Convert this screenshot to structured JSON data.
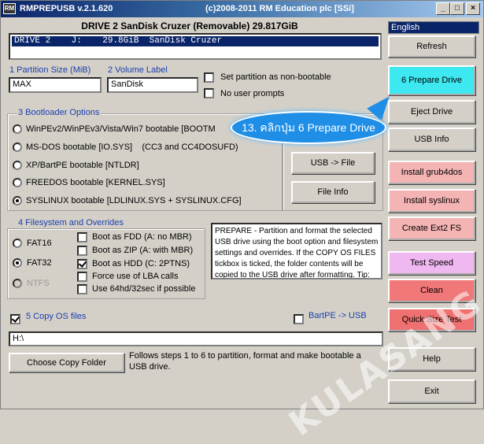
{
  "titlebar": {
    "app_icon": "RM",
    "app": "RMPREPUSB v.2.1.620",
    "copyright": "(c)2008-2011 RM Education plc [SSi]",
    "minimize": "_",
    "maximize": "□",
    "close": "×"
  },
  "drive": {
    "title": "DRIVE 2  SanDisk Cruzer  (Removable) 29.817GiB",
    "list_row": "DRIVE 2    J:    29.8GiB  SanDisk Cruzer"
  },
  "language": "English",
  "partition": {
    "size_label": "1 Partition Size (MiB)",
    "size_value": "MAX",
    "volume_label": "2 Volume Label",
    "volume_value": "SanDisk",
    "non_bootable": "Set partition as non-bootable",
    "no_prompts": "No user prompts"
  },
  "bootloader": {
    "title": "3 Bootloader Options",
    "options": [
      "WinPEv2/WinPEv3/Vista/Win7 bootable [BOOTM",
      "MS-DOS bootable [IO.SYS]    (CC3 and CC4DOSUFD)",
      "XP/BartPE bootable [NTLDR]",
      "FREEDOS bootable [KERNEL.SYS]",
      "SYSLINUX bootable [LDLINUX.SYS + SYSLINUX.CFG]"
    ]
  },
  "mid_buttons": {
    "usb_to_file": "USB -> File",
    "file_info": "File Info"
  },
  "filesystem": {
    "title": "4 Filesystem and Overrides",
    "fat16": "FAT16",
    "fat32": "FAT32",
    "ntfs": "NTFS",
    "boot_fdd": "Boot as FDD (A: no MBR)",
    "boot_zip": "Boot as ZIP (A: with MBR)",
    "boot_hdd": "Boot as HDD (C: 2PTNS)",
    "force_lba": "Force use of LBA calls",
    "use_64hd": "Use 64hd/32sec if possible"
  },
  "info_text": "PREPARE - Partition and format the selected USB drive using the boot option and filesystem settings and overrides. If the COPY OS FILES tickbox is ticked, the folder contents will be copied to the USB drive after formatting. Tip: Use",
  "copy": {
    "label": "5 Copy OS files",
    "bartpe": "BartPE -> USB",
    "path": "H:\\",
    "choose_button": "Choose Copy Folder",
    "follow_text": "Follows steps 1 to 6 to partition, format and make bootable a USB drive."
  },
  "right_buttons": {
    "refresh": "Refresh",
    "prepare": "6 Prepare Drive",
    "eject": "Eject Drive",
    "usb_info": "USB Info",
    "install_grub": "Install grub4dos",
    "install_syslinux": "Install syslinux",
    "create_ext2": "Create Ext2 FS",
    "test_speed": "Test Speed",
    "clean": "Clean",
    "quick_size": "Quick Size Test",
    "help": "Help",
    "exit": "Exit"
  },
  "callout": "13. คลิกปุ่ม 6 Prepare Drive",
  "watermark": "KULASANG.NET",
  "colors": {
    "prepare": "#3ee8f0",
    "install": "#f4b4b4",
    "test_speed": "#f0b8f0",
    "clean": "#f07878",
    "quick_size": "#ef7070",
    "callout": "#1e8ee6"
  }
}
